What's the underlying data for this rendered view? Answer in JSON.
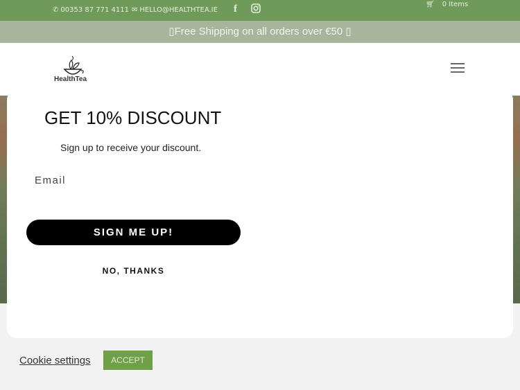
{
  "topbar": {
    "phone": "00353 87 771 4111",
    "email": "HELLO@HEALTHTEA.IE",
    "cart": "0 Items",
    "icons": [
      "phone-icon",
      "mail-icon",
      "facebook-icon",
      "instagram-icon",
      "cart-icon"
    ]
  },
  "banner": {
    "text": "Free Shipping on all orders over €50"
  },
  "header": {
    "logo_text": "HealthTea"
  },
  "modal": {
    "title": "GET 10% DISCOUNT",
    "subtitle": "Sign up to receive your discount.",
    "email_placeholder": "Email",
    "signup_label": "SIGN ME UP!",
    "decline_label": "NO, THANKS"
  },
  "cookie": {
    "settings_label": "Cookie settings",
    "accept_label": "ACCEPT"
  },
  "colors": {
    "topbar": "#6f9a5a",
    "banner": "#a6b59c",
    "signup_button": "#000000",
    "accept_button": "#6fa048"
  }
}
